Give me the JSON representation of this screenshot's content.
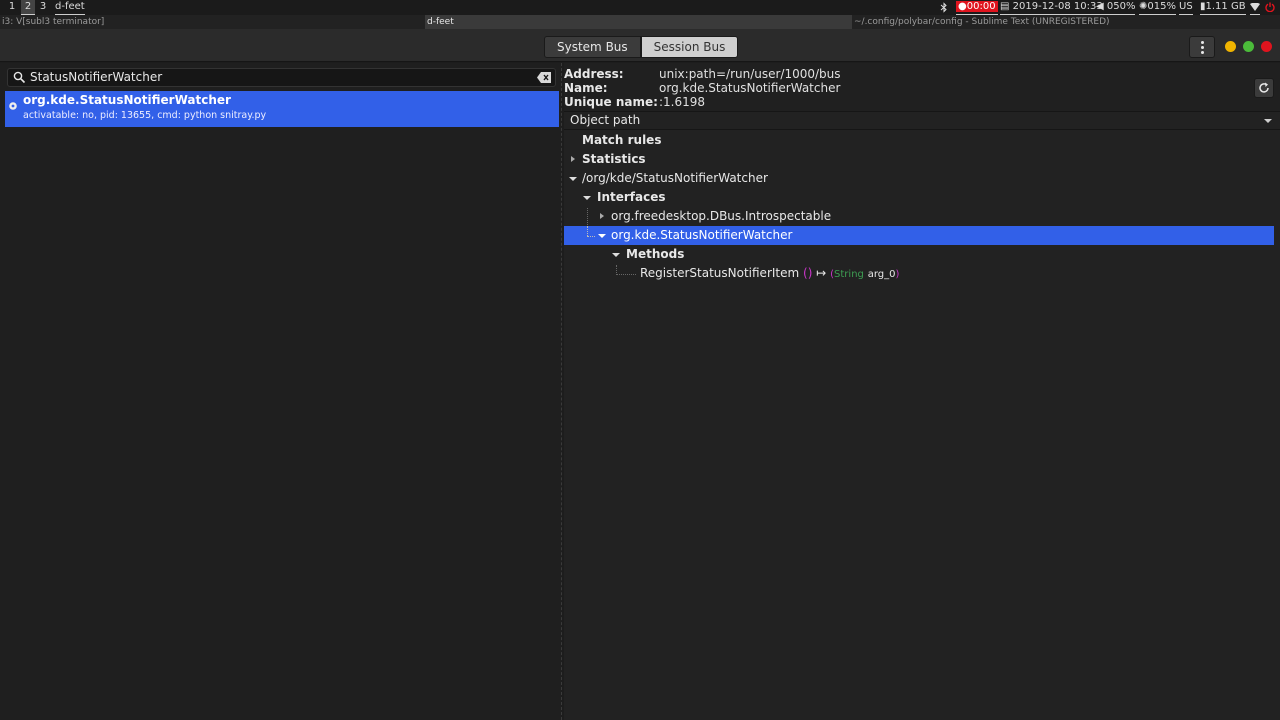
{
  "polybar": {
    "workspaces": [
      "1",
      "2",
      "3"
    ],
    "window_title": "d-feet",
    "bluetooth_icon": "bluetooth-icon",
    "record_time": "00:00",
    "datetime": "2019-12-08 10:33",
    "volume": "050%",
    "brightness": "015%",
    "keyboard_layout": "US",
    "memory": "1.11 GB"
  },
  "i3_tabs": {
    "tab1": "i3: V[subl3 terminator]",
    "tab2": "d-feet",
    "tab3": "~/.config/polybar/config - Sublime Text (UNREGISTERED)"
  },
  "header": {
    "system_bus_label": "System Bus",
    "session_bus_label": "Session Bus"
  },
  "search": {
    "value": "StatusNotifierWatcher"
  },
  "results": [
    {
      "name": "org.kde.StatusNotifierWatcher",
      "details": "activatable: no, pid: 13655, cmd: python snitray.py"
    }
  ],
  "info": {
    "address_label": "Address:",
    "address_value": "unix:path=/run/user/1000/bus",
    "name_label": "Name:",
    "name_value": "org.kde.StatusNotifierWatcher",
    "unique_label": "Unique name:",
    "unique_value": ":1.6198"
  },
  "tree": {
    "header": "Object path",
    "match_rules": "Match rules",
    "statistics": "Statistics",
    "object_path": "/org/kde/StatusNotifierWatcher",
    "interfaces": "Interfaces",
    "iface_introspectable": "org.freedesktop.DBus.Introspectable",
    "iface_watcher": "org.kde.StatusNotifierWatcher",
    "methods": "Methods",
    "method_name": "RegisterStatusNotifierItem",
    "method_in": "()",
    "method_arrow": "↦",
    "method_out_open": "(",
    "method_out_type": "String",
    "method_out_arg": "arg_0",
    "method_out_close": ")"
  },
  "colors": {
    "selection": "#3260e8",
    "record": "#e0141e",
    "close": "#e0141e",
    "minimize": "#f0b400",
    "maximize": "#4bbb3a"
  }
}
